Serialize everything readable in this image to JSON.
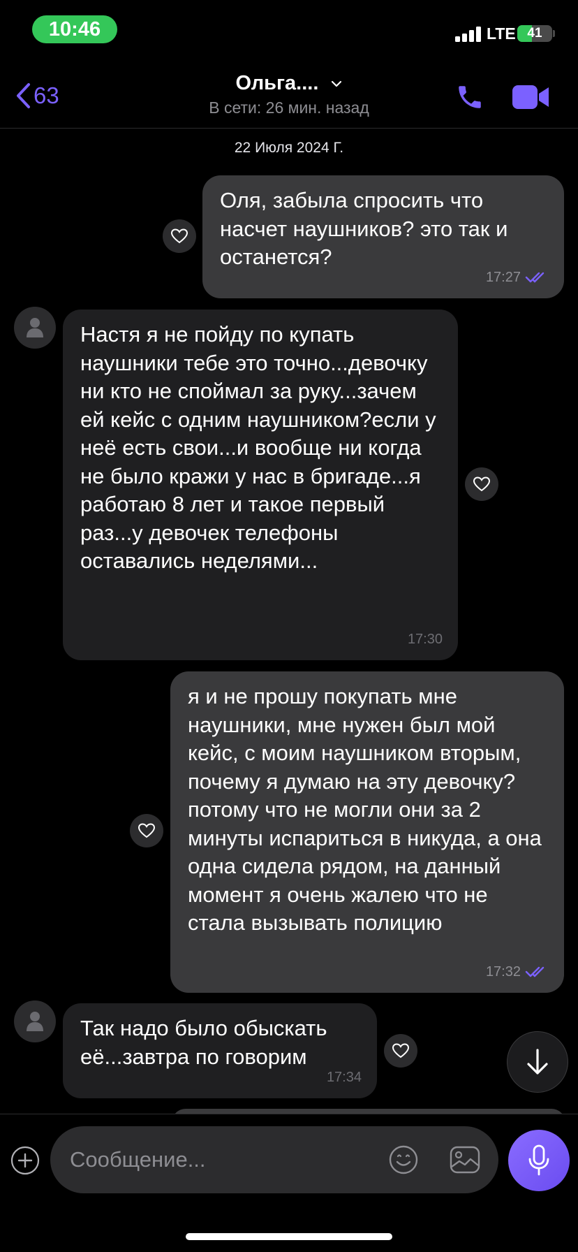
{
  "status_bar": {
    "time": "10:46",
    "network": "LTE",
    "battery_percent": "41",
    "battery_level": 0.41
  },
  "header": {
    "back_count": "63",
    "contact_name": "Ольга....",
    "contact_status": "В сети: 26 мин. назад"
  },
  "date_separator": "22 Июля 2024 Г.",
  "messages": [
    {
      "direction": "out",
      "text": "Оля, забыла спросить что насчет наушников? это так и останется?",
      "time": "17:27",
      "read": true
    },
    {
      "direction": "in",
      "text": "Настя я не пойду по купать наушники тебе это точно...девочку ни кто не споймал за руку...зачем ей кейс с одним наушником?если у неё есть свои...и вообще ни когда не было кражи у нас в бригаде...я работаю 8 лет и такое первый раз...у девочек телефоны оставались неделями...",
      "time": "17:30"
    },
    {
      "direction": "out",
      "text": "я и не прошу покупать мне наушники, мне нужен был мой кейс, с моим наушником вторым, почему я думаю на эту девочку? потому что не могли они за 2 минуты испариться в никуда, а она одна сидела рядом, на данный момент я очень жалею что не стала вызывать полицию",
      "time": "17:32",
      "read": true
    },
    {
      "direction": "in",
      "text": "Так надо было обыскать её...завтра по говорим",
      "time": "17:34"
    }
  ],
  "composer": {
    "placeholder": "Сообщение..."
  },
  "icons": {
    "back": "chevron-left-icon",
    "dropdown": "chevron-down-icon",
    "call": "phone-icon",
    "video": "video-camera-icon",
    "like": "heart-icon",
    "avatar": "person-icon",
    "scroll": "arrow-down-icon",
    "add": "plus-circle-icon",
    "emoji": "smiley-icon",
    "gallery": "gallery-icon",
    "mic": "microphone-icon"
  },
  "colors": {
    "accent": "#7b61ff",
    "background": "#000000",
    "outgoing_bubble": "#3a3a3c",
    "incoming_bubble": "#1f1f21",
    "status_green": "#34c759"
  }
}
